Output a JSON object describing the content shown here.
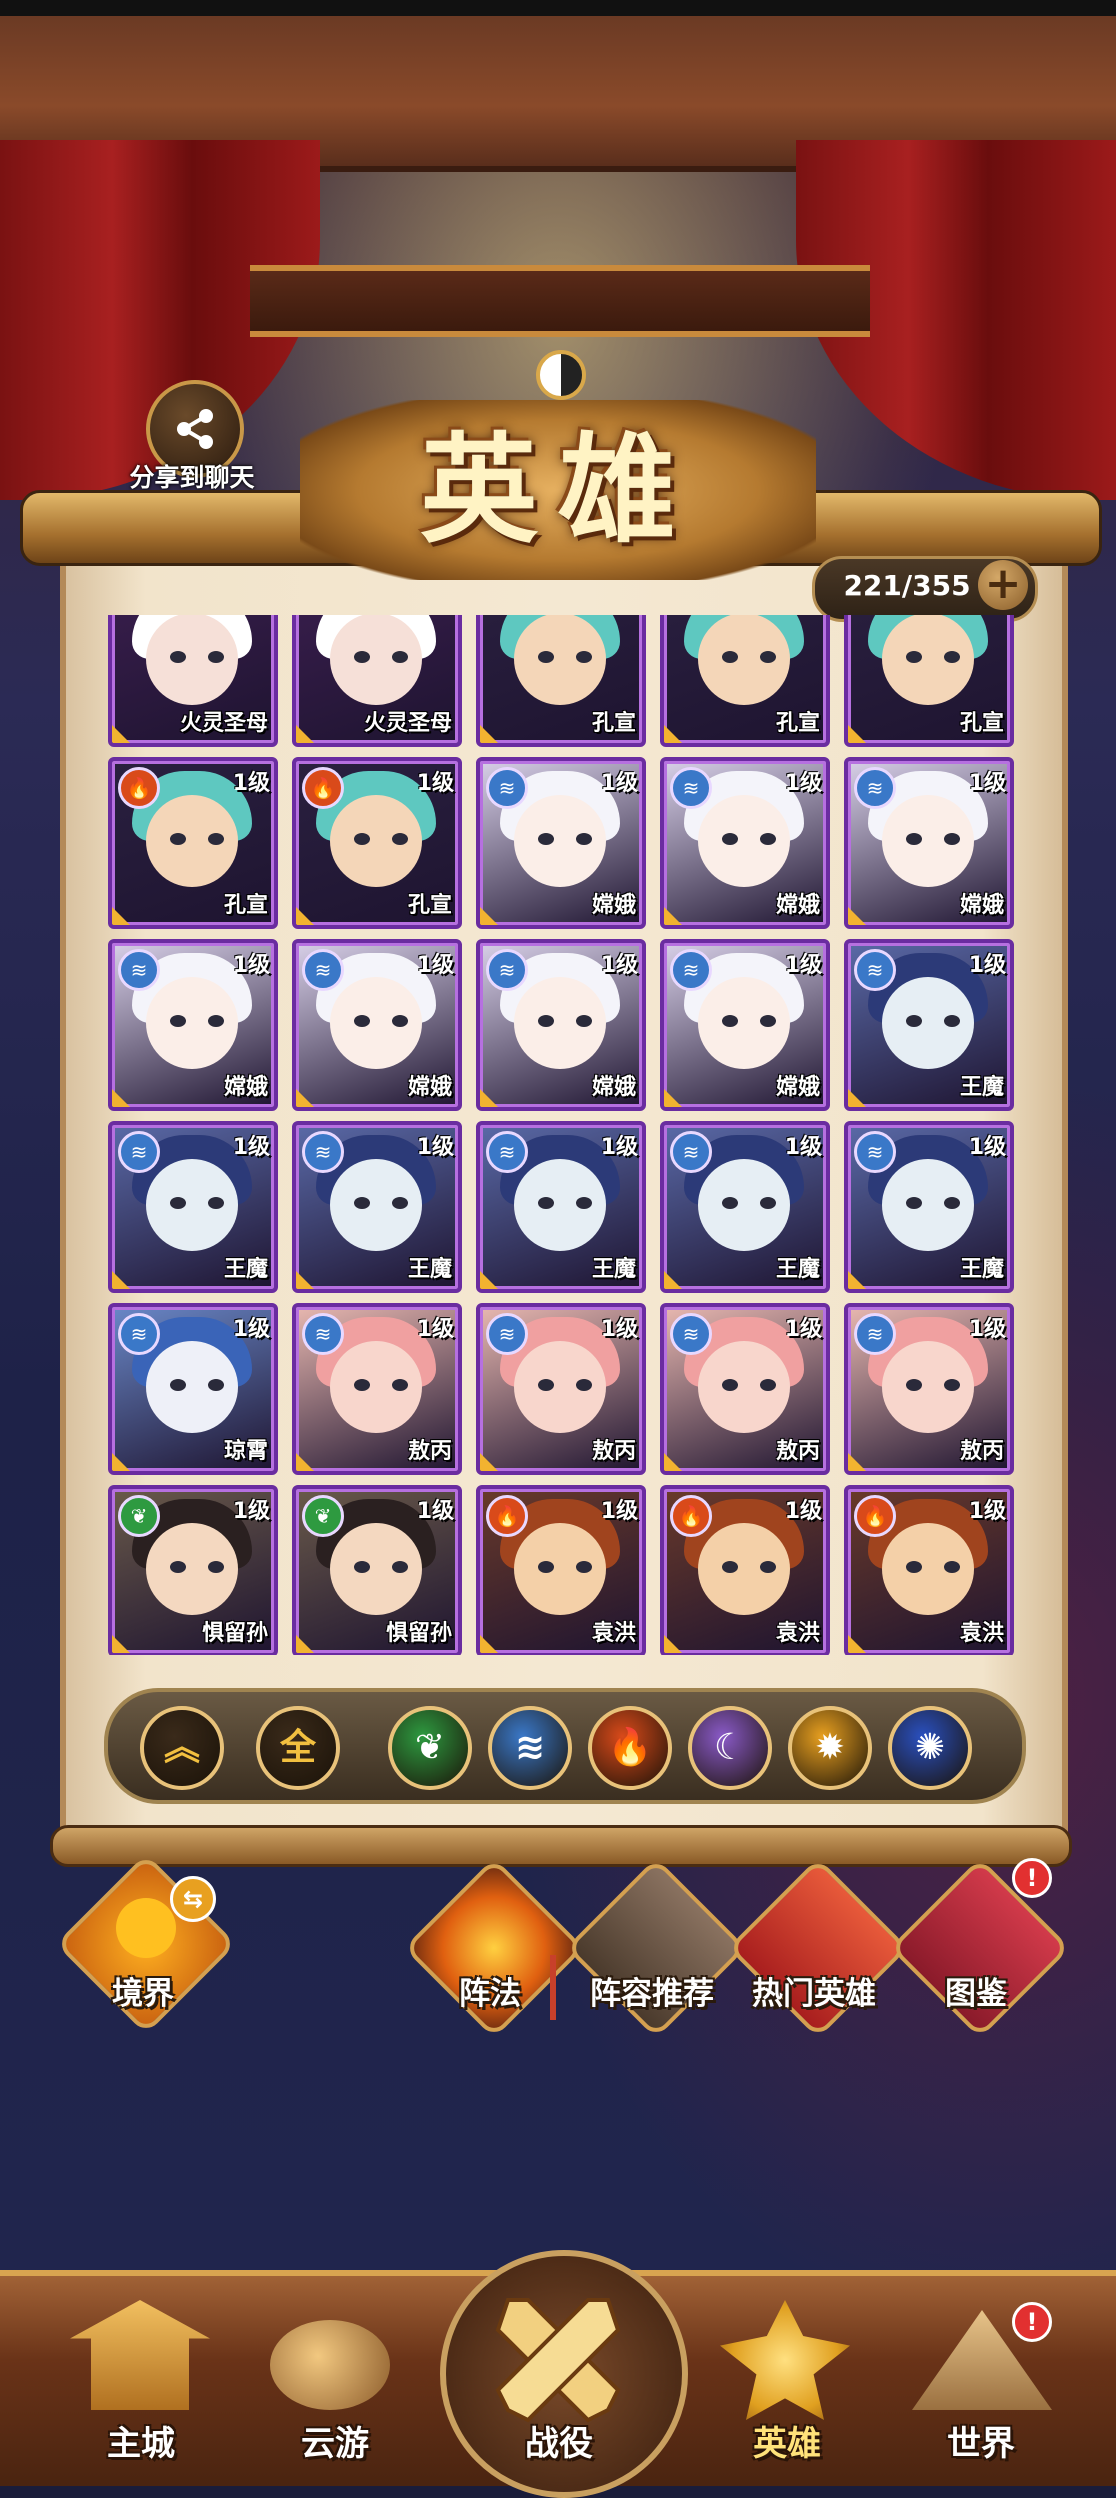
{
  "share": {
    "label": "分享到聊天"
  },
  "title": "英雄",
  "hero_count": "221/355",
  "add_symbol": "+",
  "heroes": [
    {
      "name": "火灵圣母",
      "element": "fire",
      "level": "",
      "skin": "#f6e0d8",
      "hair": "#ffffff",
      "card": "#3a1e4e"
    },
    {
      "name": "火灵圣母",
      "element": "fire",
      "level": "",
      "skin": "#f6e0d8",
      "hair": "#ffffff",
      "card": "#3a1e4e"
    },
    {
      "name": "孔宣",
      "element": "fire",
      "level": "",
      "skin": "#f4d6b8",
      "hair": "#5ec8c0",
      "card": "#2a2040"
    },
    {
      "name": "孔宣",
      "element": "fire",
      "level": "",
      "skin": "#f4d6b8",
      "hair": "#5ec8c0",
      "card": "#2a2040"
    },
    {
      "name": "孔宣",
      "element": "fire",
      "level": "",
      "skin": "#f4d6b8",
      "hair": "#5ec8c0",
      "card": "#2a2040"
    },
    {
      "name": "孔宣",
      "element": "fire",
      "level": "1级",
      "skin": "#f4d6b8",
      "hair": "#5ec8c0",
      "card": "#2a2040"
    },
    {
      "name": "孔宣",
      "element": "fire",
      "level": "1级",
      "skin": "#f4d6b8",
      "hair": "#5ec8c0",
      "card": "#2a2040"
    },
    {
      "name": "嫦娥",
      "element": "water",
      "level": "1级",
      "skin": "#fbeee8",
      "hair": "#f4f4fa",
      "card": "#d8d0e8"
    },
    {
      "name": "嫦娥",
      "element": "water",
      "level": "1级",
      "skin": "#fbeee8",
      "hair": "#f4f4fa",
      "card": "#d8d0e8"
    },
    {
      "name": "嫦娥",
      "element": "water",
      "level": "1级",
      "skin": "#fbeee8",
      "hair": "#f4f4fa",
      "card": "#d8d0e8"
    },
    {
      "name": "嫦娥",
      "element": "water",
      "level": "1级",
      "skin": "#fbeee8",
      "hair": "#f4f4fa",
      "card": "#d8d0e8"
    },
    {
      "name": "嫦娥",
      "element": "water",
      "level": "1级",
      "skin": "#fbeee8",
      "hair": "#f4f4fa",
      "card": "#d8d0e8"
    },
    {
      "name": "嫦娥",
      "element": "water",
      "level": "1级",
      "skin": "#fbeee8",
      "hair": "#f4f4fa",
      "card": "#d8d0e8"
    },
    {
      "name": "嫦娥",
      "element": "water",
      "level": "1级",
      "skin": "#fbeee8",
      "hair": "#f4f4fa",
      "card": "#d8d0e8"
    },
    {
      "name": "王魔",
      "element": "water",
      "level": "1级",
      "skin": "#e6eef4",
      "hair": "#2c3a78",
      "card": "#5a6aa8"
    },
    {
      "name": "王魔",
      "element": "water",
      "level": "1级",
      "skin": "#e6eef4",
      "hair": "#2c3a78",
      "card": "#5a6aa8"
    },
    {
      "name": "王魔",
      "element": "water",
      "level": "1级",
      "skin": "#e6eef4",
      "hair": "#2c3a78",
      "card": "#5a6aa8"
    },
    {
      "name": "王魔",
      "element": "water",
      "level": "1级",
      "skin": "#e6eef4",
      "hair": "#2c3a78",
      "card": "#5a6aa8"
    },
    {
      "name": "王魔",
      "element": "water",
      "level": "1级",
      "skin": "#e6eef4",
      "hair": "#2c3a78",
      "card": "#5a6aa8"
    },
    {
      "name": "王魔",
      "element": "water",
      "level": "1级",
      "skin": "#e6eef4",
      "hair": "#2c3a78",
      "card": "#5a6aa8"
    },
    {
      "name": "琼霄",
      "element": "water",
      "level": "1级",
      "skin": "#eef0f8",
      "hair": "#3a64b8",
      "card": "#6a88c8"
    },
    {
      "name": "敖丙",
      "element": "water",
      "level": "1级",
      "skin": "#f8d6cc",
      "hair": "#f0a0a0",
      "card": "#e8b8b0"
    },
    {
      "name": "敖丙",
      "element": "water",
      "level": "1级",
      "skin": "#f8d6cc",
      "hair": "#f0a0a0",
      "card": "#e8b8b0"
    },
    {
      "name": "敖丙",
      "element": "water",
      "level": "1级",
      "skin": "#f8d6cc",
      "hair": "#f0a0a0",
      "card": "#e8b8b0"
    },
    {
      "name": "敖丙",
      "element": "water",
      "level": "1级",
      "skin": "#f8d6cc",
      "hair": "#f0a0a0",
      "card": "#e8b8b0"
    },
    {
      "name": "惧留孙",
      "element": "wood",
      "level": "1级",
      "skin": "#f4d8c0",
      "hair": "#2a2020",
      "card": "#6a5a4a"
    },
    {
      "name": "惧留孙",
      "element": "wood",
      "level": "1级",
      "skin": "#f4d8c0",
      "hair": "#2a2020",
      "card": "#6a5a4a"
    },
    {
      "name": "袁洪",
      "element": "fire",
      "level": "1级",
      "skin": "#f4d0a8",
      "hair": "#a0441e",
      "card": "#6a3a2a"
    },
    {
      "name": "袁洪",
      "element": "fire",
      "level": "1级",
      "skin": "#f4d0a8",
      "hair": "#a0441e",
      "card": "#6a3a2a"
    },
    {
      "name": "袁洪",
      "element": "fire",
      "level": "1级",
      "skin": "#f4d0a8",
      "hair": "#a0441e",
      "card": "#6a3a2a"
    }
  ],
  "element_icons": {
    "fire": {
      "glyph": "🔥",
      "color": "#d94a1a"
    },
    "water": {
      "glyph": "≋",
      "color": "#3a78c8"
    },
    "wood": {
      "glyph": "❦",
      "color": "#2e9a40"
    }
  },
  "filters": [
    {
      "id": "collapse",
      "glyph": "︽",
      "color": "#3a2a1a",
      "text_color": "#f2c040"
    },
    {
      "id": "all",
      "glyph": "全",
      "color": "#3a2a1a",
      "text_color": "#f2c040"
    },
    {
      "id": "wood",
      "glyph": "❦",
      "color": "#2e9a40",
      "text_color": "#ffffff"
    },
    {
      "id": "water",
      "glyph": "≋",
      "color": "#3a78c8",
      "text_color": "#ffffff"
    },
    {
      "id": "fire",
      "glyph": "🔥",
      "color": "#d94a1a",
      "text_color": "#ffffff"
    },
    {
      "id": "moon",
      "glyph": "☾",
      "color": "#8a5ac8",
      "text_color": "#ffffff"
    },
    {
      "id": "sun",
      "glyph": "✹",
      "color": "#e8a020",
      "text_color": "#ffffff"
    },
    {
      "id": "void",
      "glyph": "✺",
      "color": "#2a50c0",
      "text_color": "#ffffff"
    }
  ],
  "features": {
    "realm": "境界",
    "formation": "阵法",
    "lineup": "阵容推荐",
    "hot_heroes": "热门英雄",
    "codex": "图鉴",
    "codex_badge": "!",
    "realm_swap": "⇆"
  },
  "nav": {
    "main_city": "主城",
    "travel": "云游",
    "battle": "战役",
    "heroes": "英雄",
    "world": "世界",
    "world_badge": "!"
  }
}
